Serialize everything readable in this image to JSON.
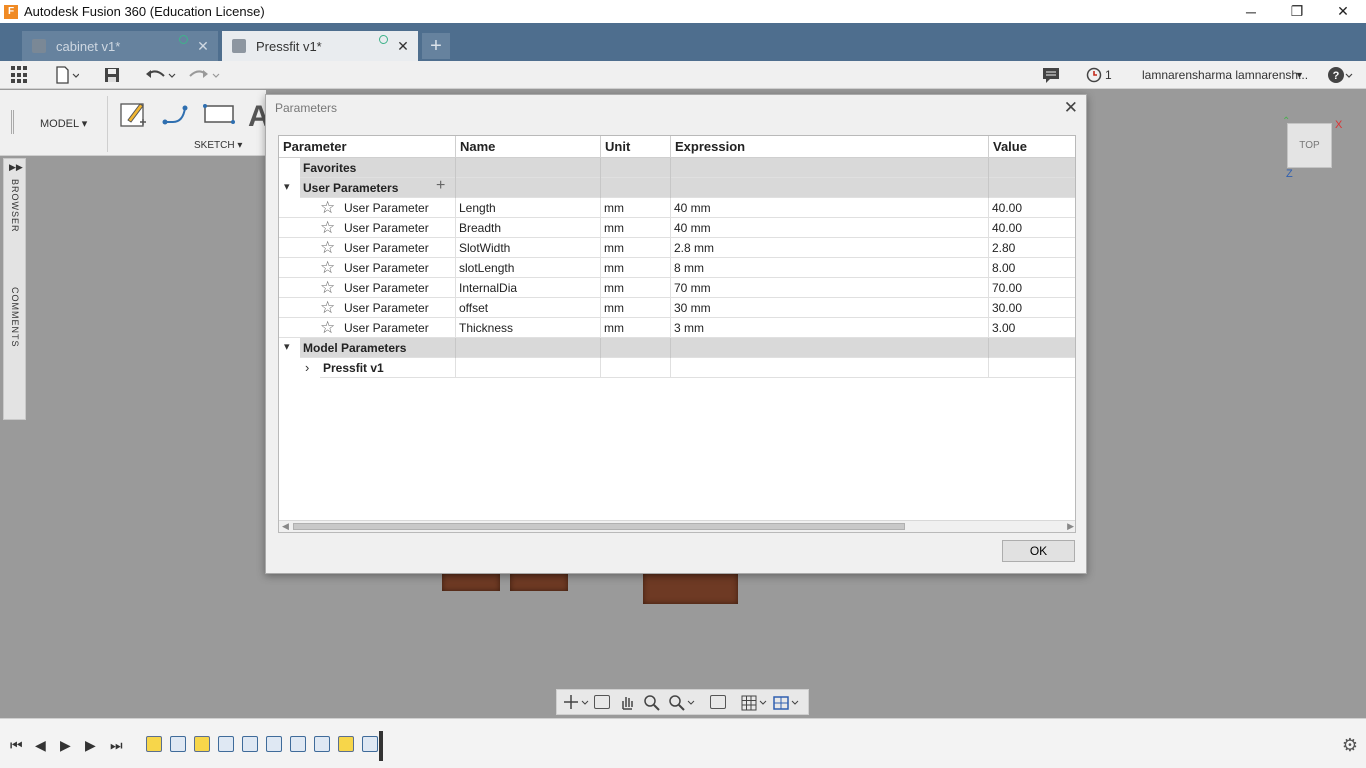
{
  "window": {
    "title": "Autodesk Fusion 360 (Education License)",
    "minimize": "─",
    "restore": "❐",
    "close": "✕"
  },
  "tabs": [
    {
      "label": "cabinet v1*",
      "active": false
    },
    {
      "label": "Pressfit v1*",
      "active": true
    }
  ],
  "tab_close": "✕",
  "tab_add": "+",
  "qat": {
    "notifications_count": "1",
    "user_name": "lamnarensharma lamnarensh...",
    "help": "?"
  },
  "ribbon": {
    "workspace": "MODEL ▾",
    "sketch_label": "SKETCH ▾"
  },
  "browser_panel": {
    "browser_label": "BROWSER",
    "comments_label": "COMMENTS"
  },
  "viewcube": {
    "face": "TOP",
    "axis_x": "X",
    "axis_z": "Z"
  },
  "dialog": {
    "title": "Parameters",
    "close": "✕",
    "columns": [
      "Parameter",
      "Name",
      "Unit",
      "Expression",
      "Value"
    ],
    "favorites_label": "Favorites",
    "user_group_label": "User Parameters",
    "user_parameters": [
      {
        "type": "User Parameter",
        "name": "Length",
        "unit": "mm",
        "expression": "40 mm",
        "value": "40.00"
      },
      {
        "type": "User Parameter",
        "name": "Breadth",
        "unit": "mm",
        "expression": "40 mm",
        "value": "40.00"
      },
      {
        "type": "User Parameter",
        "name": "SlotWidth",
        "unit": "mm",
        "expression": "2.8 mm",
        "value": "2.80"
      },
      {
        "type": "User Parameter",
        "name": "slotLength",
        "unit": "mm",
        "expression": "8 mm",
        "value": "8.00"
      },
      {
        "type": "User Parameter",
        "name": "InternalDia",
        "unit": "mm",
        "expression": "70 mm",
        "value": "70.00"
      },
      {
        "type": "User Parameter",
        "name": "offset",
        "unit": "mm",
        "expression": "30 mm",
        "value": "30.00"
      },
      {
        "type": "User Parameter",
        "name": "Thickness",
        "unit": "mm",
        "expression": "3 mm",
        "value": "3.00"
      }
    ],
    "model_group_label": "Model Parameters",
    "model_children": [
      "Pressfit v1"
    ],
    "ok_label": "OK"
  },
  "icons": {
    "star": "☆",
    "chevron_down": "⌄",
    "chevron_right": "›",
    "plus": "+",
    "gear": "⚙"
  }
}
